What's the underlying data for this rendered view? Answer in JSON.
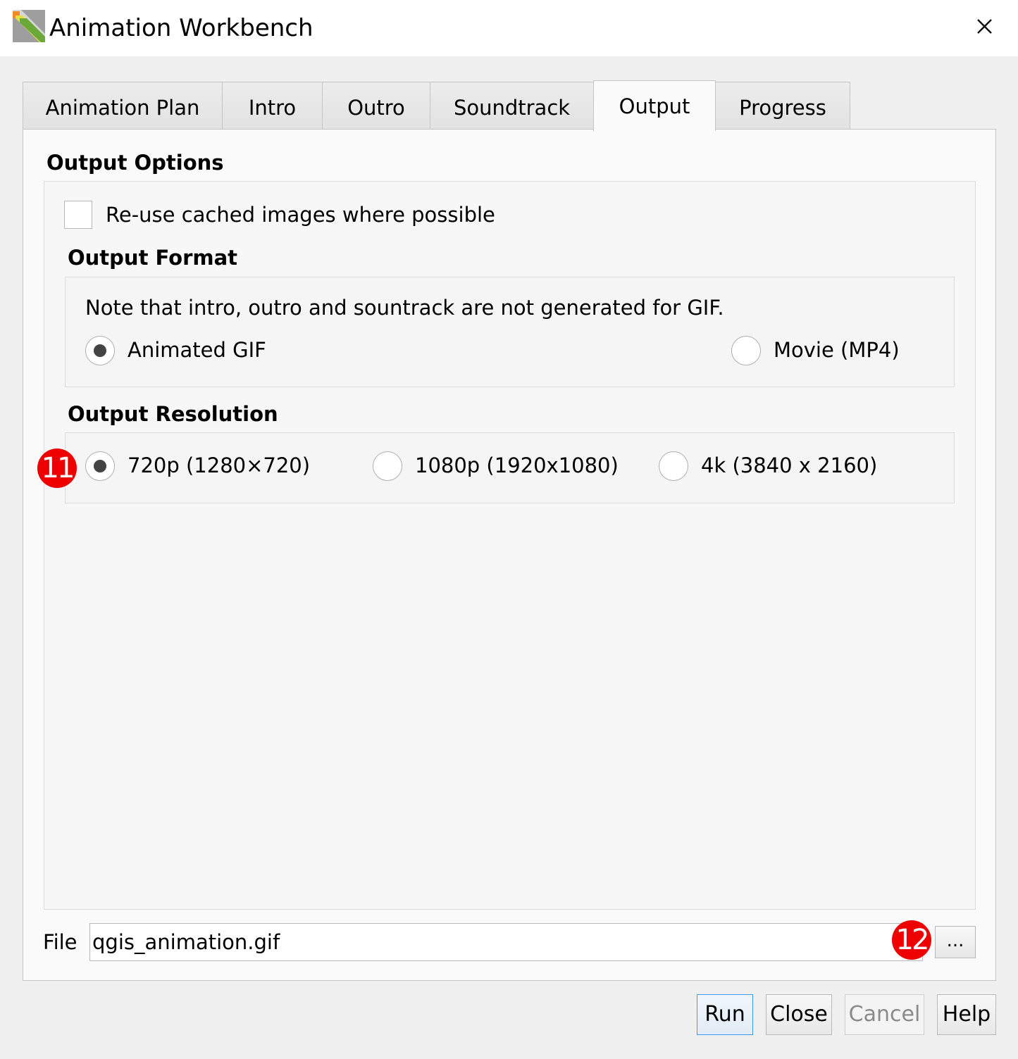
{
  "window": {
    "title": "Animation Workbench",
    "app_icon": "qgis-animation-workbench-icon",
    "close_icon": "close-icon"
  },
  "tabs": [
    {
      "label": "Animation Plan",
      "active": false
    },
    {
      "label": "Intro",
      "active": false
    },
    {
      "label": "Outro",
      "active": false
    },
    {
      "label": "Soundtrack",
      "active": false
    },
    {
      "label": "Output",
      "active": true
    },
    {
      "label": "Progress",
      "active": false
    }
  ],
  "output_options": {
    "title": "Output Options",
    "reuse_cached": {
      "label": "Re-use cached images where possible",
      "checked": false
    },
    "format": {
      "title": "Output Format",
      "note": "Note that intro, outro and sountrack are not generated for GIF.",
      "options": [
        {
          "label": "Animated GIF",
          "checked": true
        },
        {
          "label": "Movie (MP4)",
          "checked": false
        }
      ]
    },
    "resolution": {
      "title": "Output Resolution",
      "options": [
        {
          "label": "720p (1280×720)",
          "checked": true
        },
        {
          "label": "1080p (1920x1080)",
          "checked": false
        },
        {
          "label": "4k (3840 x 2160)",
          "checked": false
        }
      ]
    }
  },
  "file": {
    "label": "File",
    "value": "qgis_animation.gif",
    "browse_label": "..."
  },
  "annotations": [
    {
      "number": "11",
      "color": "#ee0000"
    },
    {
      "number": "12",
      "color": "#ee0000"
    }
  ],
  "buttons": {
    "run": "Run",
    "close": "Close",
    "cancel": "Cancel",
    "help": "Help"
  }
}
